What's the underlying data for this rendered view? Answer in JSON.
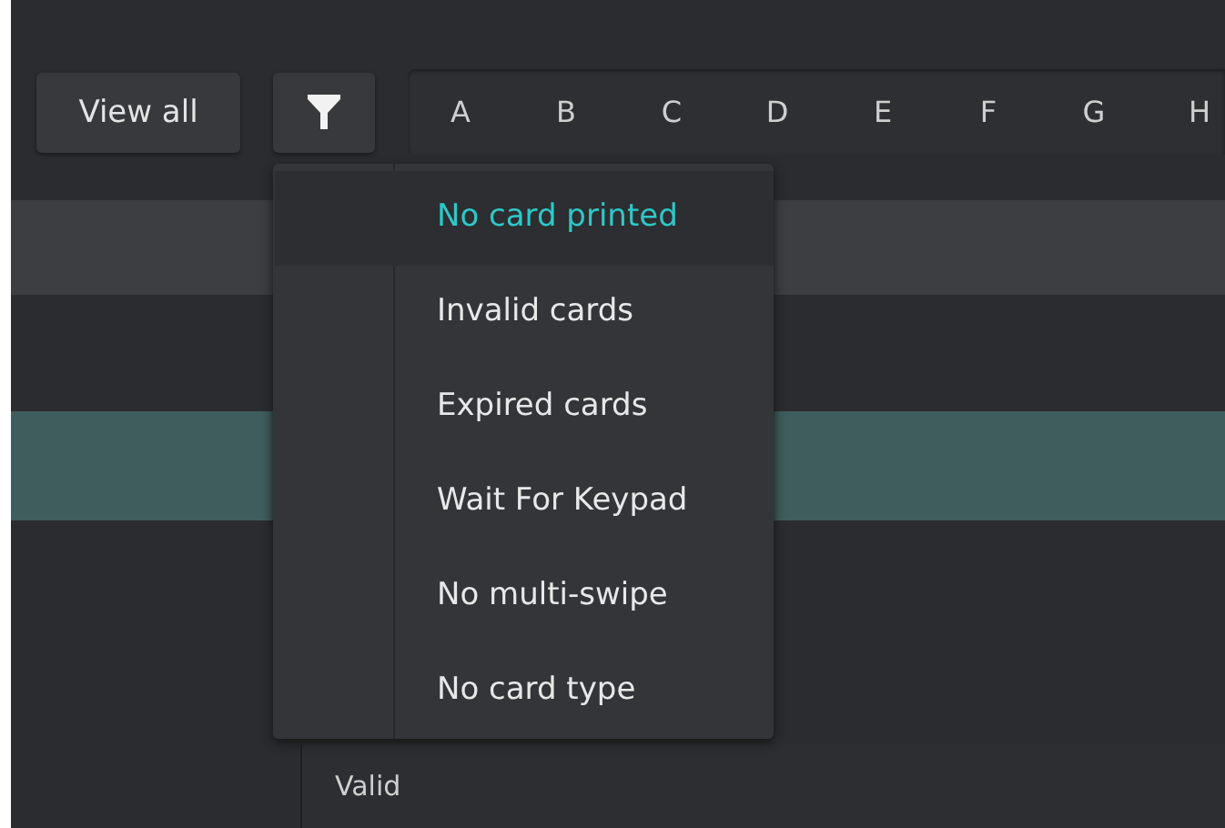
{
  "toolbar": {
    "view_all": "View all",
    "letters": [
      "A",
      "B",
      "C",
      "D",
      "E",
      "F",
      "G",
      "H"
    ]
  },
  "filter_menu": {
    "items": [
      {
        "label": "No card printed",
        "selected": true
      },
      {
        "label": "Invalid cards",
        "selected": false
      },
      {
        "label": "Expired cards",
        "selected": false
      },
      {
        "label": "Wait For Keypad",
        "selected": false
      },
      {
        "label": "No multi-swipe",
        "selected": false
      },
      {
        "label": "No card type",
        "selected": false
      }
    ]
  },
  "table": {
    "cell": "Valid"
  }
}
